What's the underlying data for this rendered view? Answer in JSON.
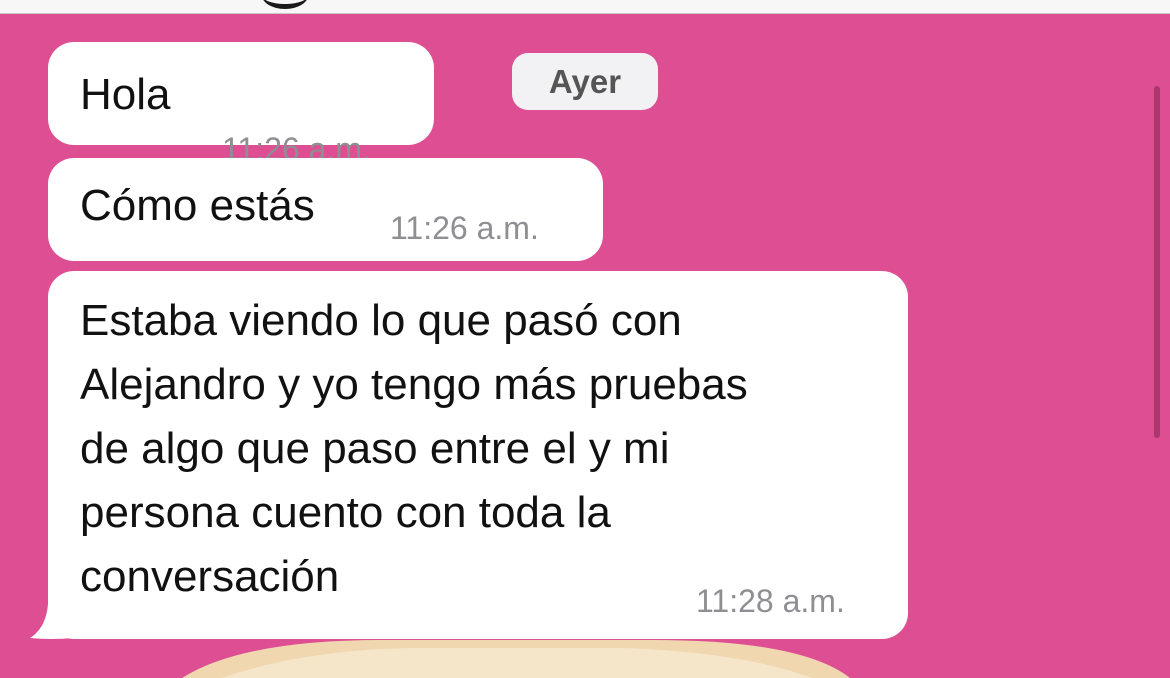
{
  "chat": {
    "date_separator": "Ayer",
    "messages": [
      {
        "text": "Hola",
        "time": "11:26 a.m."
      },
      {
        "text": "Cómo estás",
        "time": "11:26 a.m."
      },
      {
        "text": "Estaba viendo lo que pasó con\nAlejandro y yo tengo más pruebas\nde algo que paso entre el y mi\npersona cuento con toda la\nconversación",
        "time": "11:28 a.m."
      }
    ]
  },
  "colors": {
    "background": "#dd4f92",
    "bubble": "#ffffff",
    "timestamp": "#8e8e93"
  }
}
